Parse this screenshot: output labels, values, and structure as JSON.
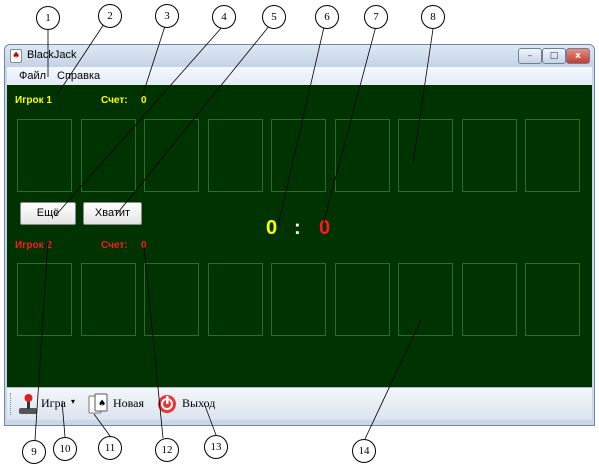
{
  "window": {
    "title": "BlackJack",
    "controls": {
      "minimize": "–",
      "maximize": "□",
      "close": "x"
    }
  },
  "menu": {
    "items": [
      "Файл",
      "Справка"
    ]
  },
  "player1": {
    "label": "Игрок 1",
    "score_label": "Счет:",
    "score": "0",
    "color": "#ffff00"
  },
  "player2": {
    "label": "Игрок 2",
    "score_label": "Счет:",
    "score": "0",
    "color": "#ff1a1a"
  },
  "actions": {
    "more": "Ещё",
    "enough": "Хватит"
  },
  "scoreboard": {
    "left": "0",
    "separator": ":",
    "right": "0"
  },
  "toolbar": {
    "game": "Игра",
    "new": "Новая",
    "exit": "Выход"
  },
  "callouts": [
    "1",
    "2",
    "3",
    "4",
    "5",
    "6",
    "7",
    "8",
    "9",
    "10",
    "11",
    "12",
    "13",
    "14"
  ],
  "colors": {
    "table": "#003300",
    "slot_border": "#2f6b2f"
  }
}
